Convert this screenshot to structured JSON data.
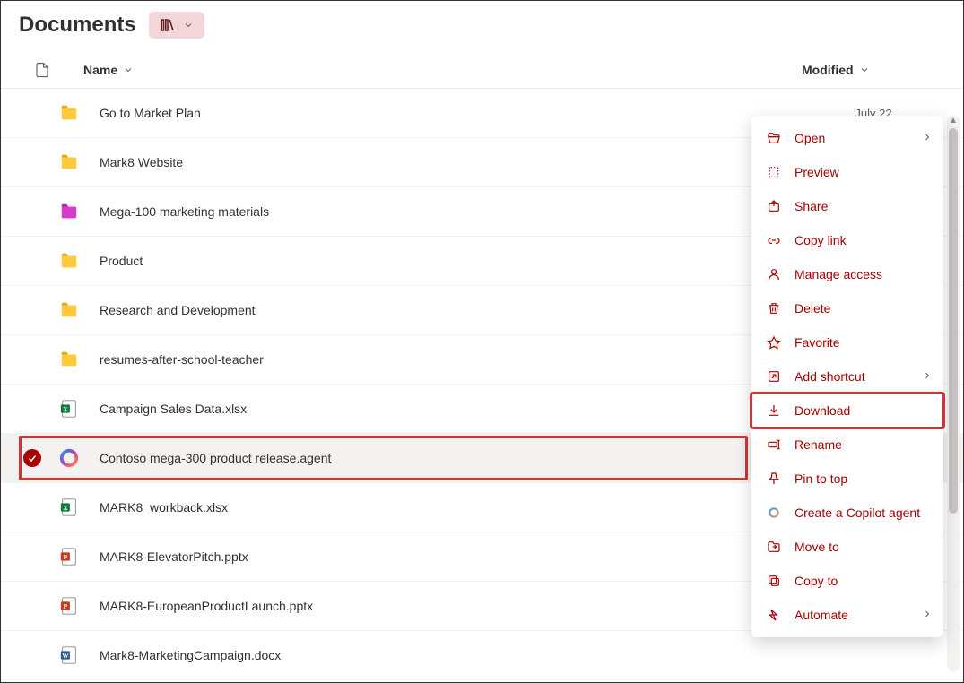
{
  "header": {
    "title": "Documents"
  },
  "columns": {
    "name": "Name",
    "modified": "Modified"
  },
  "rows": [
    {
      "icon": "folder",
      "name": "Go to Market Plan",
      "modified": "July 22",
      "selected": false,
      "highlight": false
    },
    {
      "icon": "folder",
      "name": "Mark8 Website",
      "modified": "",
      "selected": false,
      "highlight": false
    },
    {
      "icon": "folder-pink",
      "name": "Mega-100 marketing materials",
      "modified": "",
      "selected": false,
      "highlight": false
    },
    {
      "icon": "folder",
      "name": "Product",
      "modified": "",
      "selected": false,
      "highlight": false
    },
    {
      "icon": "folder",
      "name": "Research and Development",
      "modified": "",
      "selected": false,
      "highlight": false
    },
    {
      "icon": "folder",
      "name": "resumes-after-school-teacher",
      "modified": "",
      "selected": false,
      "highlight": false
    },
    {
      "icon": "excel",
      "name": "Campaign Sales Data.xlsx",
      "modified": "",
      "selected": false,
      "highlight": false
    },
    {
      "icon": "copilot",
      "name": "Contoso mega-300 product release.agent",
      "modified": "",
      "selected": true,
      "highlight": true
    },
    {
      "icon": "excel",
      "name": "MARK8_workback.xlsx",
      "modified": "",
      "selected": false,
      "highlight": false
    },
    {
      "icon": "ppt",
      "name": "MARK8-ElevatorPitch.pptx",
      "modified": "",
      "selected": false,
      "highlight": false
    },
    {
      "icon": "ppt",
      "name": "MARK8-EuropeanProductLaunch.pptx",
      "modified": "",
      "selected": false,
      "highlight": false
    },
    {
      "icon": "word",
      "name": "Mark8-MarketingCampaign.docx",
      "modified": "",
      "selected": false,
      "highlight": false
    }
  ],
  "context_menu": [
    {
      "icon": "open",
      "label": "Open",
      "submenu": true,
      "highlight": false
    },
    {
      "icon": "preview",
      "label": "Preview",
      "submenu": false,
      "highlight": false
    },
    {
      "icon": "share",
      "label": "Share",
      "submenu": false,
      "highlight": false
    },
    {
      "icon": "link",
      "label": "Copy link",
      "submenu": false,
      "highlight": false
    },
    {
      "icon": "access",
      "label": "Manage access",
      "submenu": false,
      "highlight": false
    },
    {
      "icon": "delete",
      "label": "Delete",
      "submenu": false,
      "highlight": false
    },
    {
      "icon": "favorite",
      "label": "Favorite",
      "submenu": false,
      "highlight": false
    },
    {
      "icon": "shortcut",
      "label": "Add shortcut",
      "submenu": true,
      "highlight": false
    },
    {
      "icon": "download",
      "label": "Download",
      "submenu": false,
      "highlight": true
    },
    {
      "icon": "rename",
      "label": "Rename",
      "submenu": false,
      "highlight": false
    },
    {
      "icon": "pin",
      "label": "Pin to top",
      "submenu": false,
      "highlight": false
    },
    {
      "icon": "copilot-new",
      "label": "Create a Copilot agent",
      "submenu": false,
      "highlight": false
    },
    {
      "icon": "moveto",
      "label": "Move to",
      "submenu": false,
      "highlight": false
    },
    {
      "icon": "copyto",
      "label": "Copy to",
      "submenu": false,
      "highlight": false
    },
    {
      "icon": "automate",
      "label": "Automate",
      "submenu": true,
      "highlight": false
    }
  ]
}
